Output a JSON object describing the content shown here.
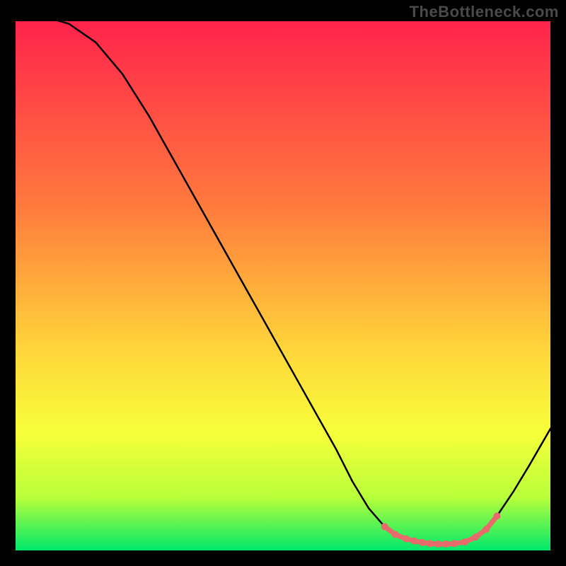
{
  "watermark": "TheBottleneck.com",
  "colors": {
    "bg": "#000000",
    "grad_top": "#ff234b",
    "grad_upper_mid": "#ff7a3d",
    "grad_mid": "#ffd53a",
    "grad_lower_mid": "#f6ff3a",
    "grad_low": "#b8ff3a",
    "grad_bottom": "#00e86b",
    "curve": "#000000",
    "marker": "#e96a6a"
  },
  "chart_data": {
    "type": "line",
    "title": "",
    "xlabel": "",
    "ylabel": "",
    "xlim": [
      0,
      100
    ],
    "ylim": [
      0,
      100
    ],
    "series": [
      {
        "name": "bottleneck-curve",
        "x": [
          0,
          5,
          10,
          15,
          20,
          25,
          30,
          35,
          40,
          45,
          50,
          55,
          60,
          63,
          66,
          69,
          72,
          75,
          78,
          81,
          84,
          87,
          90,
          93,
          96,
          100
        ],
        "y": [
          102,
          101,
          99.5,
          96,
          90,
          82,
          73,
          64,
          55,
          46,
          37,
          28,
          19,
          13,
          8,
          4.5,
          2.4,
          1.5,
          1.2,
          1.2,
          1.6,
          3.2,
          6.5,
          11,
          16,
          23
        ]
      }
    ],
    "markers": {
      "name": "optimal-range",
      "x": [
        69,
        71,
        73,
        74.5,
        76,
        77.5,
        79,
        80.5,
        82,
        84,
        86,
        88,
        90
      ],
      "y": [
        4.5,
        3.0,
        2.2,
        1.8,
        1.5,
        1.3,
        1.2,
        1.2,
        1.3,
        1.6,
        2.5,
        4.0,
        6.5
      ]
    },
    "gradient_stops": [
      {
        "offset": 0.0,
        "color_key": "grad_top"
      },
      {
        "offset": 0.35,
        "color_key": "grad_upper_mid"
      },
      {
        "offset": 0.62,
        "color_key": "grad_mid"
      },
      {
        "offset": 0.78,
        "color_key": "grad_lower_mid"
      },
      {
        "offset": 0.9,
        "color_key": "grad_low"
      },
      {
        "offset": 1.0,
        "color_key": "grad_bottom"
      }
    ]
  }
}
